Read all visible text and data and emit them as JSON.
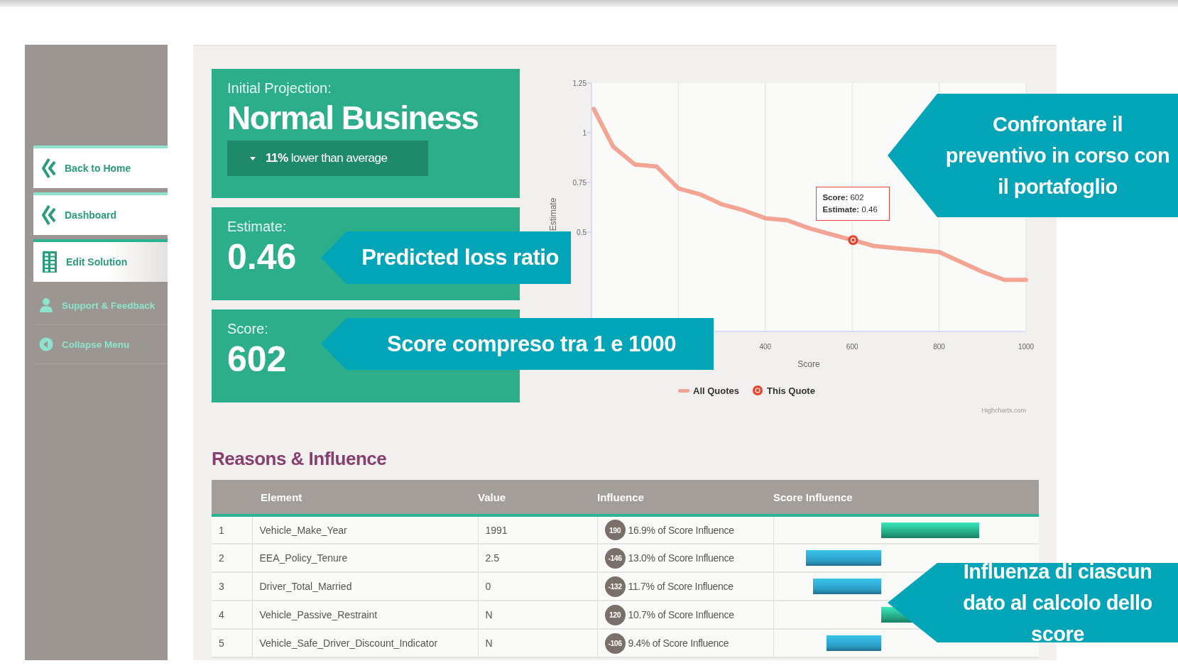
{
  "sidebar": {
    "items": [
      {
        "label": "Back to Home",
        "kind": "chevrons",
        "boxed": true,
        "selected": false
      },
      {
        "label": "Dashboard",
        "kind": "chevrons",
        "boxed": true,
        "selected": false
      },
      {
        "label": "Edit Solution",
        "kind": "sheet",
        "boxed": true,
        "selected": true
      },
      {
        "label": "Support & Feedback",
        "kind": "person",
        "boxed": false,
        "selected": false
      },
      {
        "label": "Collapse Menu",
        "kind": "collapse",
        "boxed": false,
        "selected": false
      }
    ]
  },
  "projection": {
    "label": "Initial Projection:",
    "value": "Normal Business",
    "trend": "**11%** lower than average"
  },
  "estimate": {
    "label": "Estimate:",
    "value": "0.46"
  },
  "score": {
    "label": "Score:",
    "value": "602"
  },
  "chart": {
    "tooltip": [
      "**Score:** 602",
      "**Estimate:** 0.46"
    ],
    "credit": "Highcharts.com",
    "chart_data": {
      "type": "line",
      "xlabel": "Score",
      "ylabel": "Estimate",
      "xlim": [
        0,
        1000
      ],
      "ylim": [
        0,
        1.25
      ],
      "xticks": [
        400,
        600,
        800,
        1000
      ],
      "yticks": [
        0.5,
        0.75,
        1,
        1.25
      ],
      "grid": {
        "x": true,
        "y": false
      },
      "legend": true,
      "x": [
        5,
        50,
        100,
        150,
        200,
        250,
        300,
        350,
        400,
        450,
        500,
        550,
        600,
        602,
        650,
        700,
        750,
        800,
        850,
        900,
        950,
        1000
      ],
      "series": [
        {
          "name": "All Quotes",
          "color": "#f4a493",
          "type": "line",
          "values": [
            1.12,
            0.93,
            0.84,
            0.83,
            0.72,
            0.69,
            0.64,
            0.61,
            0.57,
            0.56,
            0.52,
            0.49,
            0.46,
            0.46,
            0.43,
            0.42,
            0.41,
            0.4,
            0.35,
            0.3,
            0.26,
            0.26
          ]
        },
        {
          "name": "This Quote",
          "color": "#e8452c",
          "type": "scatter",
          "values": [
            null,
            null,
            null,
            null,
            null,
            null,
            null,
            null,
            null,
            null,
            null,
            null,
            null,
            0.46,
            null,
            null,
            null,
            null,
            null,
            null,
            null,
            null
          ]
        }
      ]
    }
  },
  "reasons": {
    "title": "Reasons & Influence",
    "table": {
      "columns": [
        "Element",
        "Value",
        "Influence",
        "Score Influence"
      ],
      "rows": [
        {
          "rank": "1",
          "element": "Vehicle_Make_Year",
          "value": "1991",
          "influence": "190",
          "share": "16.9% of Score Influence"
        },
        {
          "rank": "2",
          "element": "EEA_Policy_Tenure",
          "value": "2.5",
          "influence": "-146",
          "share": "13.0% of Score Influence"
        },
        {
          "rank": "3",
          "element": "Driver_Total_Married",
          "value": "0",
          "influence": "-132",
          "share": "11.7% of Score Influence"
        },
        {
          "rank": "4",
          "element": "Vehicle_Passive_Restraint",
          "value": "N",
          "influence": "120",
          "share": "10.7% of Score Influence"
        },
        {
          "rank": "5",
          "element": "Vehicle_Safe_Driver_Discount_Indicator",
          "value": "N",
          "influence": "-106",
          "share": "9.4% of Score Influence"
        }
      ]
    }
  },
  "callouts": [
    {
      "text": "Predicted loss ratio"
    },
    {
      "text": "Score compreso tra 1 e 1000"
    },
    {
      "text": "Confrontare il preventivo in corso con il portafoglio"
    },
    {
      "text": "Influenza di ciascun dato al calcolo dello score"
    }
  ]
}
